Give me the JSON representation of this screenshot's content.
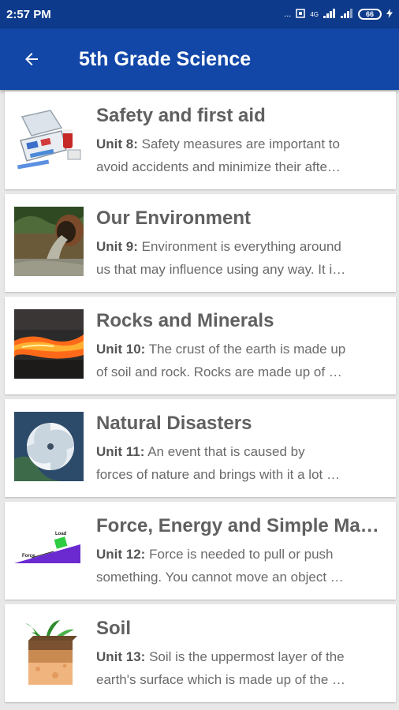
{
  "status": {
    "time": "2:57 PM",
    "dots": "...",
    "network": "4G",
    "battery": "66"
  },
  "appbar": {
    "title": "5th Grade Science"
  },
  "units": [
    {
      "title": "Safety and first aid",
      "unit": "Unit 8:",
      "line1": " Safety measures are important to",
      "line2": "avoid accidents and minimize their afte…"
    },
    {
      "title": "Our Environment",
      "unit": "Unit 9:",
      "line1": " Environment is everything around",
      "line2": "us that may influence using any way. It i…"
    },
    {
      "title": "Rocks and Minerals",
      "unit": "Unit 10:",
      "line1": " The crust of the earth is made up",
      "line2": "of soil and rock. Rocks are made up of …"
    },
    {
      "title": "Natural Disasters",
      "unit": "Unit 11:",
      "line1": " An event that is caused by",
      "line2": "forces of nature and brings with it a lot …"
    },
    {
      "title": "Force, Energy and Simple Ma…",
      "unit": "Unit 12:",
      "line1": " Force is needed to pull or push",
      "line2": "something. You cannot move an object …",
      "image_labels": {
        "load": "Load",
        "force": "Force"
      }
    },
    {
      "title": "Soil",
      "unit": "Unit 13:",
      "line1": " Soil is the uppermost layer of the",
      "line2": "earth's surface which is made up of the …"
    }
  ],
  "colors": {
    "status_bar": "#0d3a8a",
    "app_bar": "#1247a8",
    "title_text": "#606060",
    "body_text": "#6a6a6a"
  }
}
